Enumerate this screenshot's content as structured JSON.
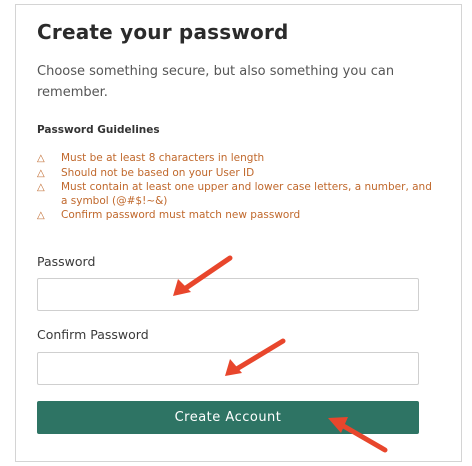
{
  "form": {
    "title": "Create your password",
    "subtitle": "Choose something secure, but also something you can remember.",
    "guidelines_heading": "Password Guidelines",
    "guidelines": [
      "Must be at least 8 characters in length",
      "Should not be based on your User ID",
      "Must contain at least one upper and lower case letters, a number, and a symbol (@#$!~&)",
      "Confirm password must match new password"
    ],
    "password_label": "Password",
    "password_value": "",
    "confirm_label": "Confirm Password",
    "confirm_value": "",
    "submit_label": "Create Account"
  },
  "icons": {
    "guideline_icon": "warning-triangle-icon"
  },
  "colors": {
    "accent_button": "#2e7464",
    "guideline_text": "#c0682c",
    "annotation_arrow": "#e8462c"
  }
}
